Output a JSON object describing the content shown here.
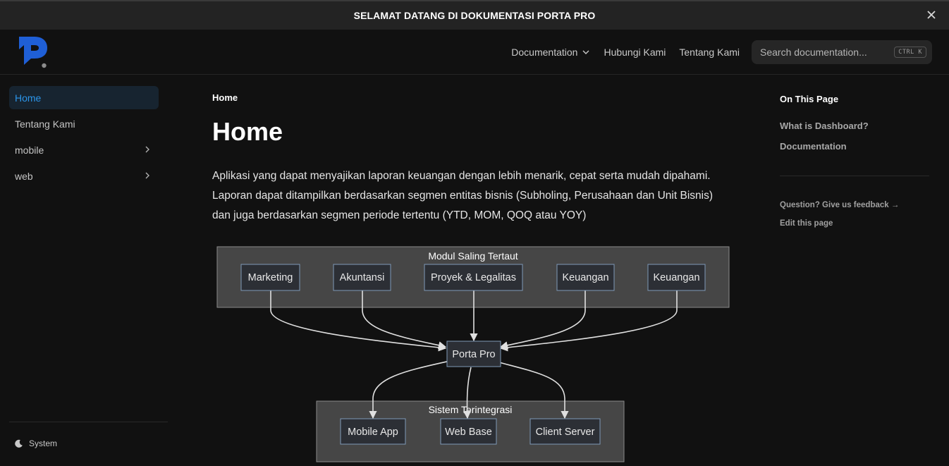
{
  "banner": {
    "text": "SELAMAT DATANG DI DOKUMENTASI PORTA PRO",
    "close_icon": "close-icon"
  },
  "navbar": {
    "logo_icon": "porta-pro-logo",
    "links": [
      {
        "label": "Documentation",
        "icon": "chevron-down-icon"
      },
      {
        "label": "Hubungi Kami"
      },
      {
        "label": "Tentang Kami"
      }
    ],
    "search": {
      "placeholder": "Search documentation...",
      "shortcut": "CTRL K"
    }
  },
  "sidebar": {
    "items": [
      {
        "label": "Home",
        "active": true
      },
      {
        "label": "Tentang Kami"
      },
      {
        "label": "mobile",
        "icon": "chevron-right-icon"
      },
      {
        "label": "web",
        "icon": "chevron-right-icon"
      }
    ],
    "theme": {
      "label": "System",
      "icon": "moon-icon"
    }
  },
  "main": {
    "breadcrumb": "Home",
    "title": "Home",
    "intro_lines": [
      "Aplikasi yang dapat menyajikan laporan keuangan dengan lebih menarik, cepat serta mudah dipahami.",
      "Laporan dapat ditampilkan berdasarkan segmen entitas bisnis (Subholing, Perusahaan dan Unit Bisnis)",
      "dan juga berdasarkan segmen periode tertentu (YTD, MOM, QOQ atau YOY)"
    ]
  },
  "diagram": {
    "top_group_label": "Modul Saling Tertaut",
    "top_nodes": [
      "Marketing",
      "Akuntansi",
      "Proyek & Legalitas",
      "Keuangan",
      "Keuangan"
    ],
    "center_node": "Porta Pro",
    "bottom_group_label": "Sistem Terintegrasi",
    "bottom_nodes": [
      "Mobile App",
      "Web Base",
      "Client Server"
    ],
    "colors": {
      "group_fill": "#464646",
      "group_border": "#8a8a8a",
      "node_fill": "#2c2f35",
      "node_border": "#7f9ab8",
      "edge": "#e0e0e0"
    }
  },
  "toc": {
    "title": "On This Page",
    "links": [
      "What is Dashboard?",
      "Documentation"
    ],
    "feedback": "Question? Give us feedback →",
    "edit": "Edit this page"
  },
  "colors": {
    "accent": "#2b95ea",
    "background": "#111111",
    "logo_blue": "#1f5fd6"
  }
}
